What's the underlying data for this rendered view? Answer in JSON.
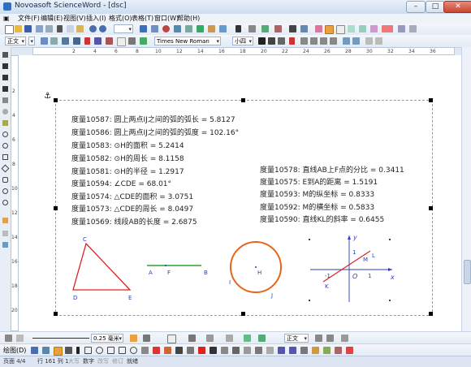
{
  "window": {
    "title": "Novoasoft ScienceWord - [dsc]"
  },
  "menubar": {
    "items": [
      "文件(F)",
      "编辑(E)",
      "视图(V)",
      "插入(I)",
      "格式(O)",
      "表格(T)",
      "窗口(W)",
      "帮助(H)"
    ]
  },
  "toolbar2": {
    "style_value": "正文",
    "font_value": "Times New Roman",
    "size_value": "小四"
  },
  "bottom_toolbar": {
    "line_width": "0.25 毫米",
    "align_value": "正文"
  },
  "measurements_left": [
    "度量10587: 圆上两点IJ之间的弧的弧长 = 5.8127",
    "度量10586: 圆上两点IJ之间的弧的弧度 = 102.16°",
    "度量10583: ⊙H的面积 = 5.2414",
    "度量10582: ⊙H的周长 = 8.1158",
    "度量10581: ⊙H的半径 = 1.2917",
    "度量10594: ∠CDE = 68.01°",
    "度量10574: △CDE的面积 = 3.0751",
    "度量10573: △CDE的周长 = 8.0497",
    "度量10569: 线段AB的长度 = 2.6875"
  ],
  "measurements_right": [
    "度量10578: 直线AB上F点的分比 = 0.3411",
    "度量10575: E到A的距离 = 1.5191",
    "度量10593: M的纵坐标 = 0.8333",
    "度量10592: M的横坐标 = 0.5833",
    "度量10590: 直线KL的斜率 = 0.6455"
  ],
  "figures": {
    "triangle": {
      "labels": [
        "C",
        "D",
        "E"
      ],
      "color": "#e02020"
    },
    "segment": {
      "labels": [
        "A",
        "F",
        "B"
      ],
      "color": "#2ca02c"
    },
    "circle": {
      "labels": [
        "H",
        "I",
        "J"
      ],
      "color": "#e8641a"
    },
    "axes": {
      "labels": [
        "y",
        "x",
        "O",
        "1",
        "-1",
        "1",
        "M",
        "L",
        "K"
      ],
      "line_color": "#e02020"
    }
  },
  "ruler": {
    "h_numbers": [
      "2",
      "4",
      "6",
      "8",
      "10",
      "12",
      "14",
      "16",
      "18",
      "20",
      "22",
      "24",
      "26",
      "28",
      "30",
      "32",
      "34",
      "36"
    ],
    "v_numbers": [
      "2",
      "4",
      "6",
      "8",
      "10",
      "12",
      "14",
      "16",
      "18",
      "20"
    ]
  },
  "status": {
    "page": "页面 4/4",
    "position": "行 161 列 1",
    "mode1": "大写",
    "mode2": "数字",
    "mode3": "改写",
    "mode4": "修订",
    "mode5": "就绪"
  },
  "bottom_label": "绘图(D)",
  "colors": {
    "accent": "#2f6fc4",
    "frame": "#999999"
  }
}
